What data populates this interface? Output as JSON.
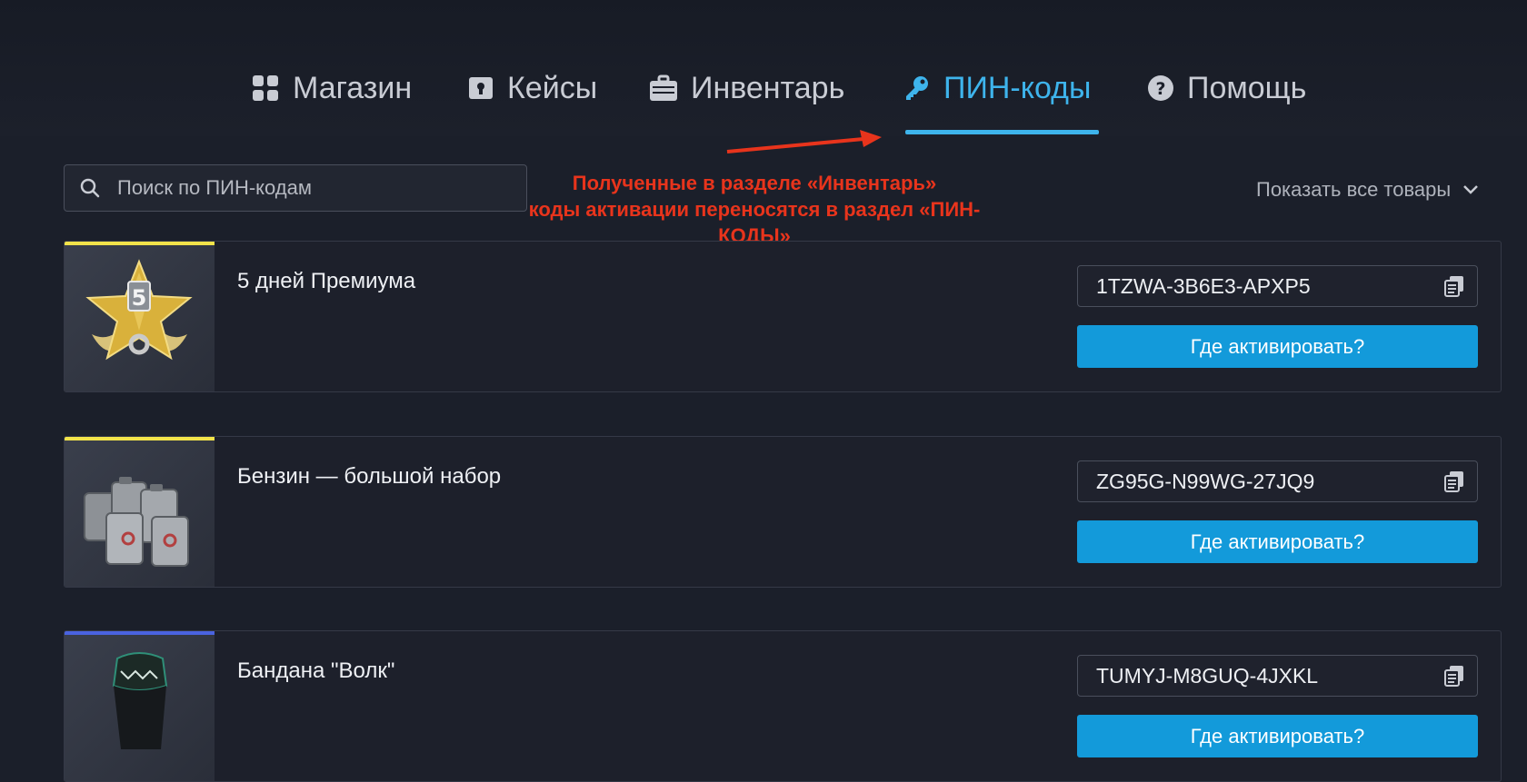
{
  "nav": {
    "tabs": [
      {
        "label": "Магазин",
        "icon": "grid-icon"
      },
      {
        "label": "Кейсы",
        "icon": "lock-box-icon"
      },
      {
        "label": "Инвентарь",
        "icon": "briefcase-icon"
      },
      {
        "label": "ПИН-коды",
        "icon": "key-icon",
        "active": true
      },
      {
        "label": "Помощь",
        "icon": "help-icon"
      }
    ]
  },
  "search": {
    "placeholder": "Поиск по ПИН-кодам"
  },
  "annotation": {
    "line1": "Полученные в разделе «Инвентарь»",
    "line2": "коды активации переносятся в раздел «ПИН-КОДЫ»"
  },
  "filter": {
    "label": "Показать все товары"
  },
  "items": [
    {
      "name": "5 дней Премиума",
      "code": "1TZWA-3B6E3-APXP5",
      "button": "Где активировать?",
      "rarity_color": "#f2e34a"
    },
    {
      "name": "Бензин — большой набор",
      "code": "ZG95G-N99WG-27JQ9",
      "button": "Где активировать?",
      "rarity_color": "#f2e34a"
    },
    {
      "name": "Бандана \"Волк\"",
      "code": "TUMYJ-M8GUQ-4JXKL",
      "button": "Где активировать?",
      "rarity_color": "#4a63e0"
    }
  ],
  "colors": {
    "accent": "#3eb4ec",
    "button": "#139ada",
    "annotation": "#e8341c",
    "background": "#1b1f2a"
  }
}
